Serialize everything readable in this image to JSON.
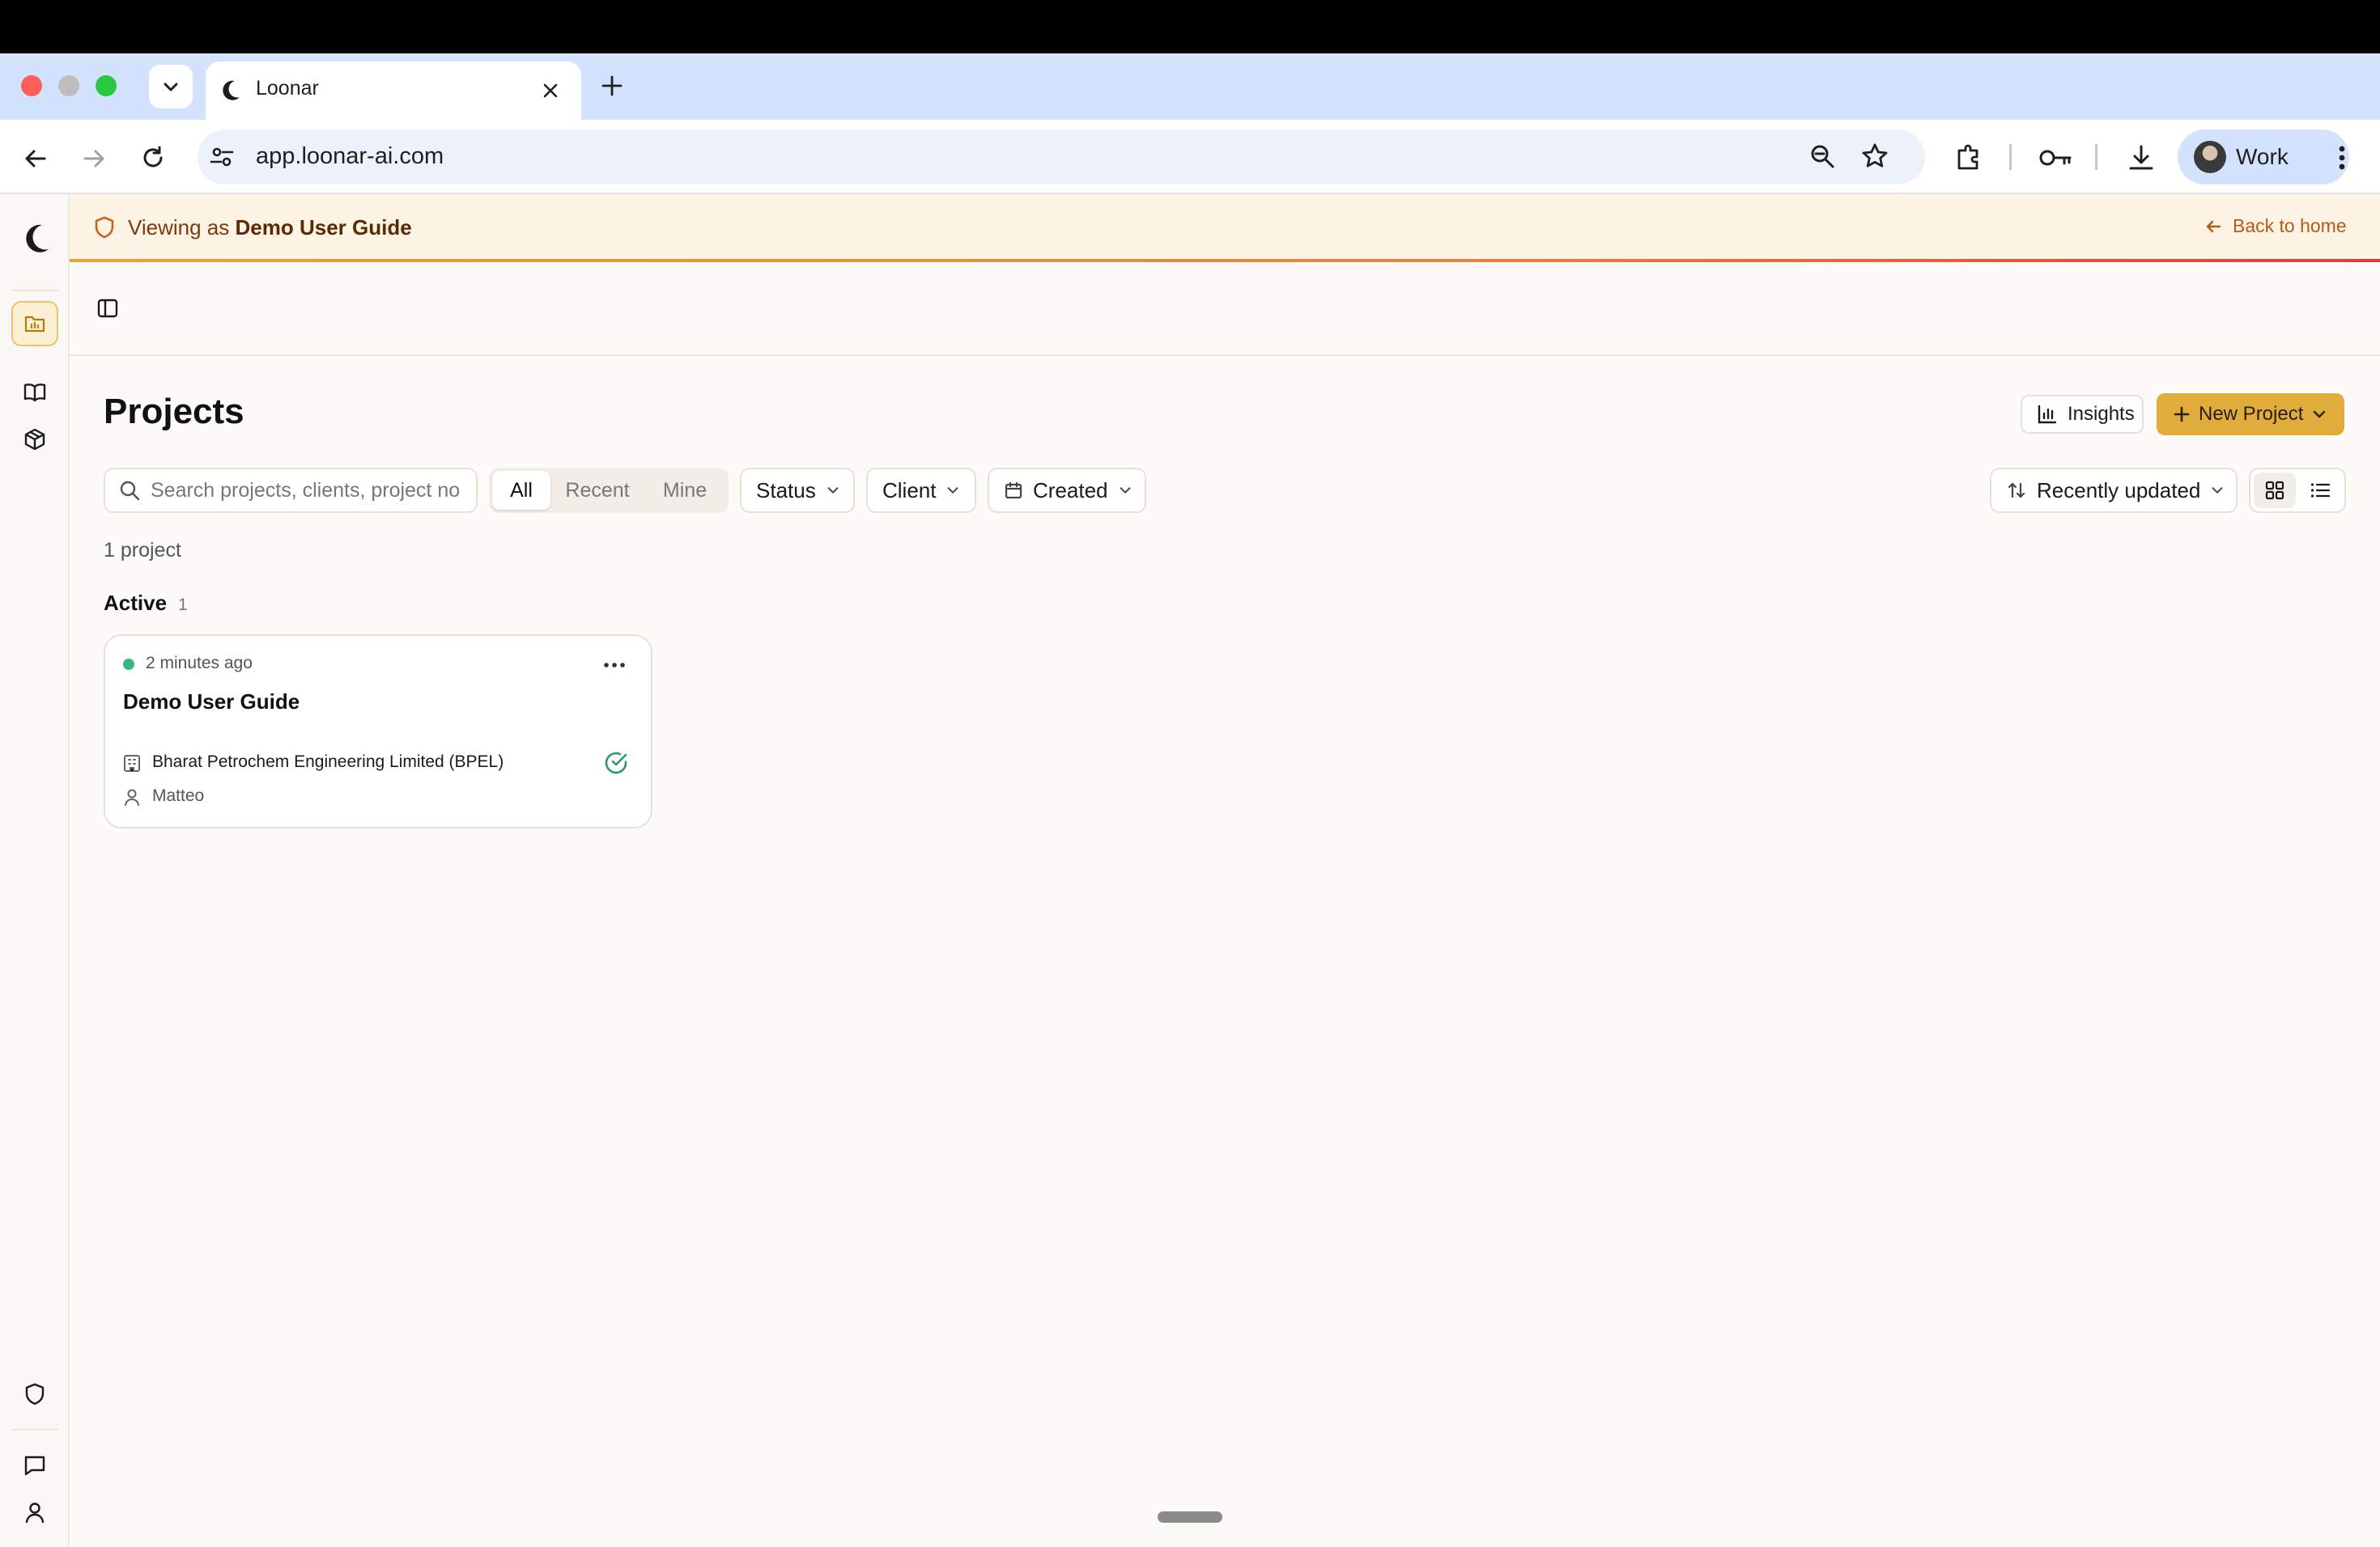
{
  "browser": {
    "tab_title": "Loonar",
    "url": "app.loonar-ai.com",
    "profile_label": "Work"
  },
  "banner": {
    "prefix": "Viewing as",
    "user": "Demo User Guide",
    "back_label": "Back to home"
  },
  "page": {
    "title": "Projects",
    "insights_label": "Insights",
    "new_project_label": "New Project"
  },
  "filters": {
    "search_placeholder": "Search projects, clients, project no",
    "segments": [
      "All",
      "Recent",
      "Mine"
    ],
    "selected_segment": "All",
    "status_label": "Status",
    "client_label": "Client",
    "created_label": "Created",
    "sort_label": "Recently updated"
  },
  "summary": {
    "count_text": "1 project"
  },
  "groups": [
    {
      "label": "Active",
      "count": "1",
      "projects": [
        {
          "updated": "2 minutes ago",
          "name": "Demo User Guide",
          "client": "Bharat Petrochem Engineering Limited (BPEL)",
          "owner": "Matteo"
        }
      ]
    }
  ],
  "colors": {
    "accent": "#e0ad3c",
    "status_active": "#3bb77e",
    "banner_bg": "#fdf3e4",
    "banner_text": "#7a3b0c"
  }
}
